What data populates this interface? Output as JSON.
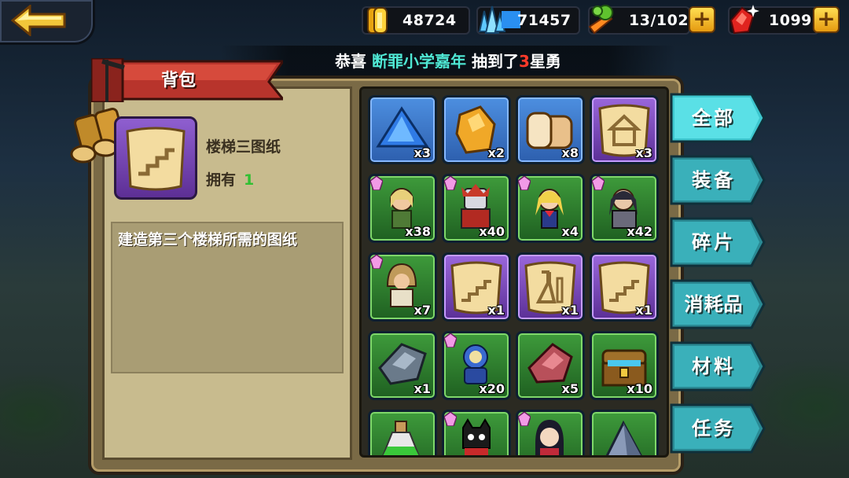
{
  "resources": {
    "gold": "48724",
    "crystal": "71457",
    "food": "13/102",
    "gem": "1099"
  },
  "announcement": {
    "prefix": "恭喜",
    "player": "断罪小学嘉年",
    "middle": "抽到了",
    "stars": "3",
    "suffix": "星勇"
  },
  "backpack": {
    "title": "背包",
    "selected": {
      "name": "楼梯三图纸",
      "own_label": "拥有",
      "own_count": "1",
      "description": "建造第三个楼梯所需的图纸"
    }
  },
  "tabs": [
    {
      "label": "全部",
      "active": true
    },
    {
      "label": "装备",
      "active": false
    },
    {
      "label": "碎片",
      "active": false
    },
    {
      "label": "消耗品",
      "active": false
    },
    {
      "label": "材料",
      "active": false
    },
    {
      "label": "任务",
      "active": false
    }
  ],
  "items": [
    {
      "name": "blue-crystal",
      "rarity": "blue",
      "count": "x3"
    },
    {
      "name": "gold-ore",
      "rarity": "blue",
      "count": "x2"
    },
    {
      "name": "bread",
      "rarity": "blue",
      "count": "x8"
    },
    {
      "name": "house-blueprint",
      "rarity": "purple",
      "count": "x3"
    },
    {
      "name": "elf-hero-fragment",
      "rarity": "green",
      "count": "x38"
    },
    {
      "name": "armored-hero-fragment",
      "rarity": "green",
      "count": "x40"
    },
    {
      "name": "sailor-hero-fragment",
      "rarity": "green",
      "count": "x4"
    },
    {
      "name": "dark-knight-fragment",
      "rarity": "green",
      "count": "x42"
    },
    {
      "name": "hooded-hero-fragment",
      "rarity": "green",
      "count": "x7"
    },
    {
      "name": "stairs-blueprint",
      "rarity": "purple",
      "count": "x1"
    },
    {
      "name": "flask-blueprint",
      "rarity": "purple",
      "count": "x1"
    },
    {
      "name": "stairs-blueprint-2",
      "rarity": "purple",
      "count": "x1"
    },
    {
      "name": "iron-ore",
      "rarity": "green",
      "count": "x1"
    },
    {
      "name": "robot-fragment",
      "rarity": "green",
      "count": "x20"
    },
    {
      "name": "red-ore",
      "rarity": "green",
      "count": "x5"
    },
    {
      "name": "treasure-chest",
      "rarity": "green",
      "count": "x10"
    },
    {
      "name": "potion",
      "rarity": "green",
      "count": ""
    },
    {
      "name": "black-cat-fragment",
      "rarity": "green",
      "count": ""
    },
    {
      "name": "girl-hero-fragment",
      "rarity": "green",
      "count": ""
    },
    {
      "name": "pyramid",
      "rarity": "green",
      "count": ""
    }
  ],
  "colors": {
    "accent_tab": "#3ec7cf",
    "count_green": "#31c032",
    "announce_name": "#4fe8d4",
    "announce_star": "#ff3a2a"
  }
}
